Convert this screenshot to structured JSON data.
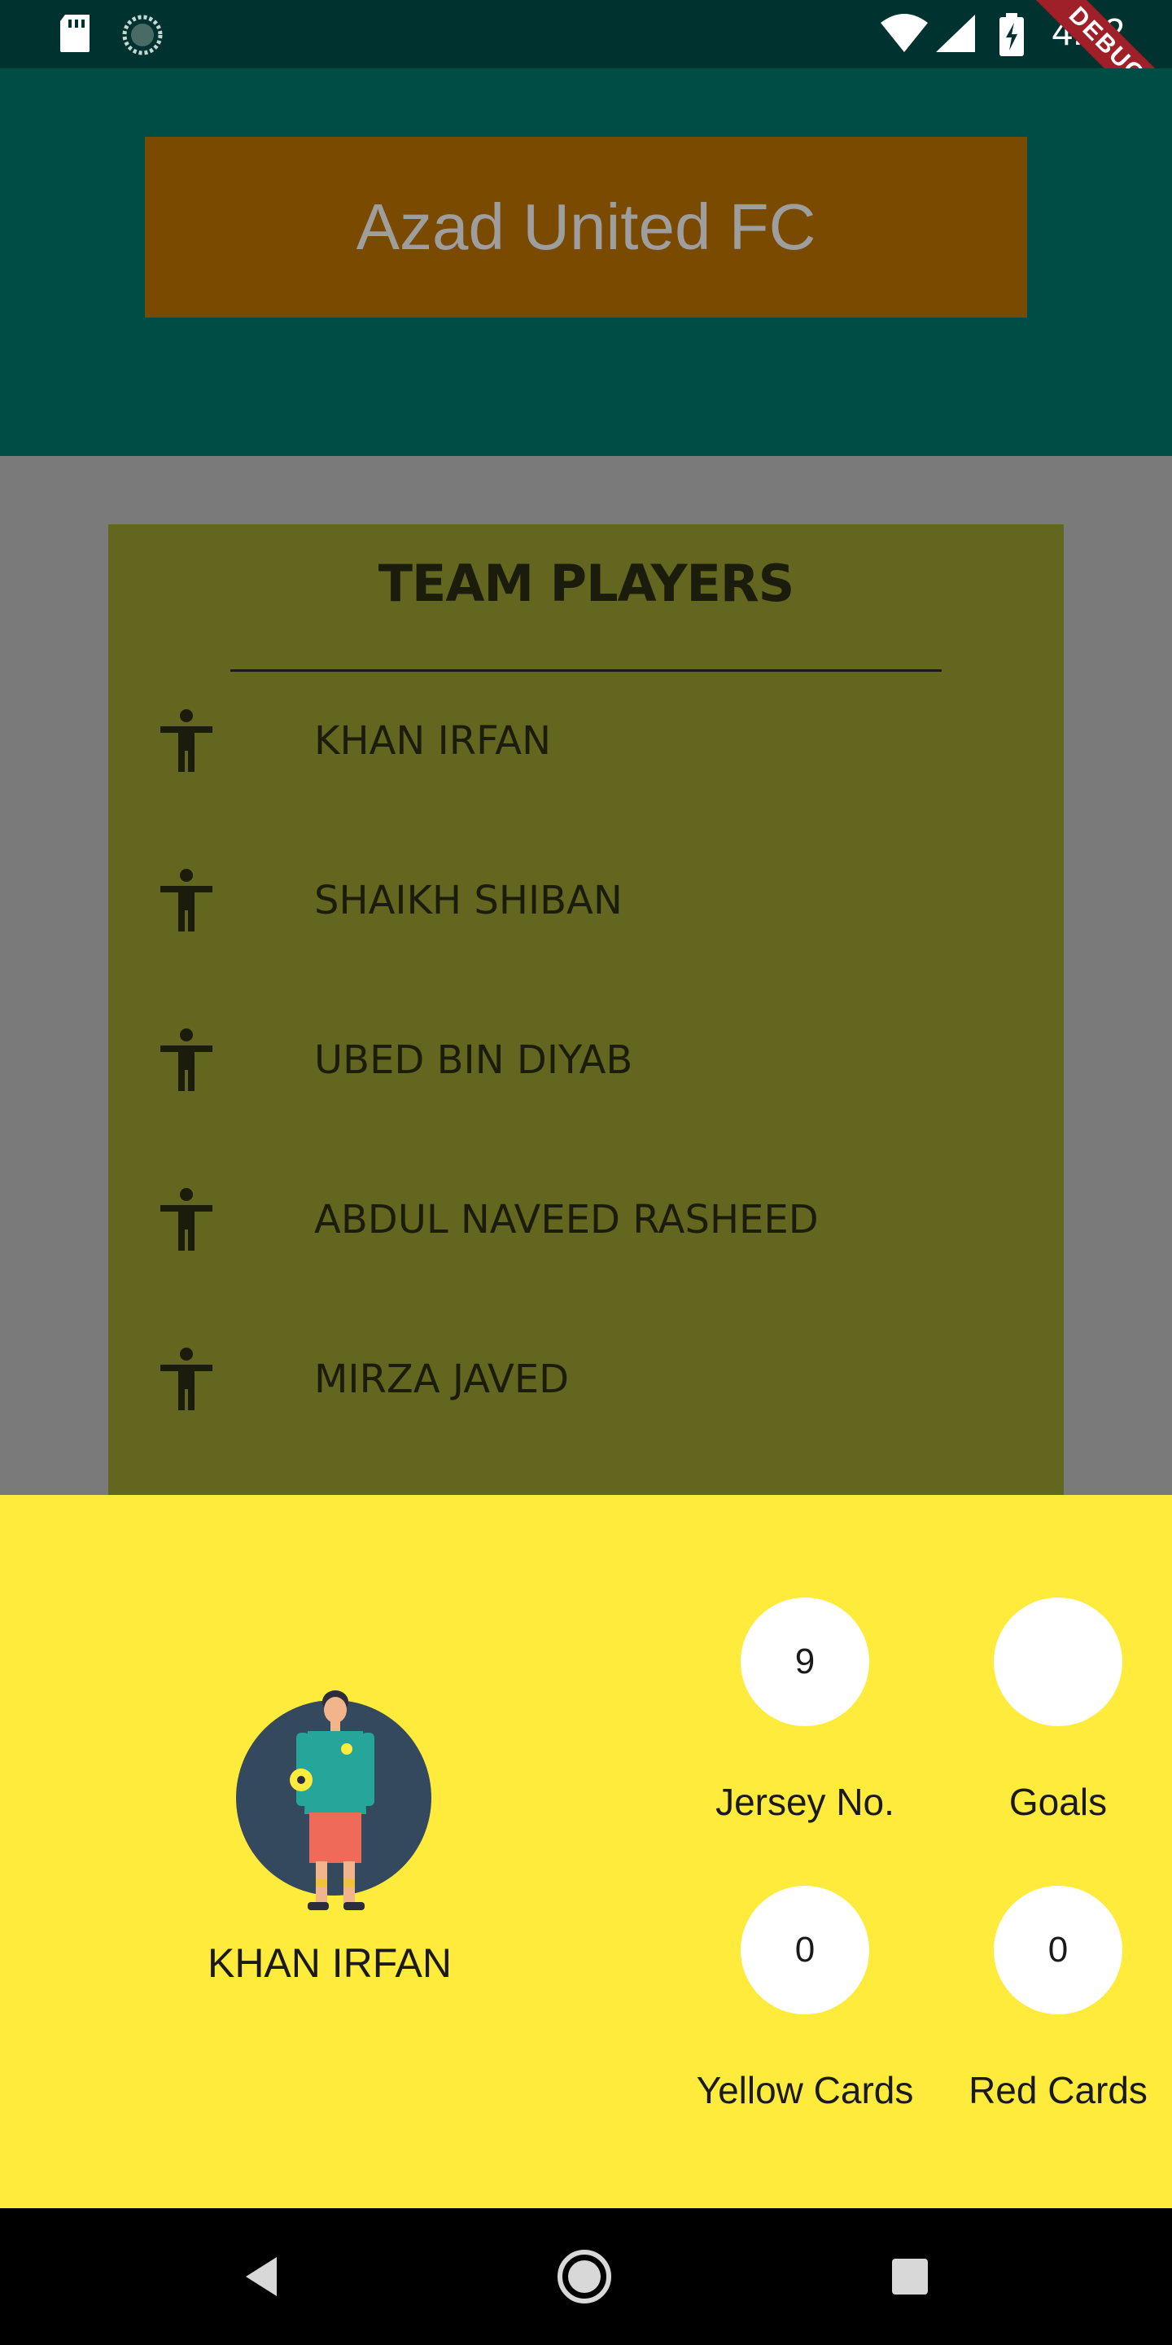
{
  "status_bar": {
    "time": "4:32",
    "icons": [
      "sd-card-icon",
      "sync-icon",
      "wifi-icon",
      "signal-icon",
      "battery-charging-icon"
    ],
    "debug_label": "DEBUG"
  },
  "app": {
    "title": "Azad United FC",
    "colors": {
      "status_bar": "#00332f",
      "app_bar": "#004d45",
      "title_box": "#7a4a00",
      "players_panel": "#62661e",
      "bottom_sheet": "#ffeb3b",
      "background": "#7a7a7a"
    }
  },
  "players": {
    "title": "TEAM PLAYERS",
    "items": [
      {
        "name": "KHAN IRFAN",
        "icon": "person-standing-icon"
      },
      {
        "name": "SHAIKH SHIBAN",
        "icon": "person-standing-icon"
      },
      {
        "name": "UBED BIN DIYAB",
        "icon": "person-standing-icon"
      },
      {
        "name": "ABDUL NAVEED RASHEED",
        "icon": "person-standing-icon"
      },
      {
        "name": "MIRZA JAVED",
        "icon": "person-standing-icon"
      }
    ]
  },
  "player_detail": {
    "name": "KHAN IRFAN",
    "avatar_icon": "soccer-player-avatar",
    "stats": {
      "jersey": {
        "label": "Jersey No.",
        "value": "9"
      },
      "goals": {
        "label": "Goals",
        "value": ""
      },
      "yellow": {
        "label": "Yellow Cards",
        "value": "0"
      },
      "red": {
        "label": "Red Cards",
        "value": "0"
      }
    }
  },
  "nav_bar": {
    "buttons": [
      "back-icon",
      "home-icon",
      "recents-icon"
    ]
  }
}
